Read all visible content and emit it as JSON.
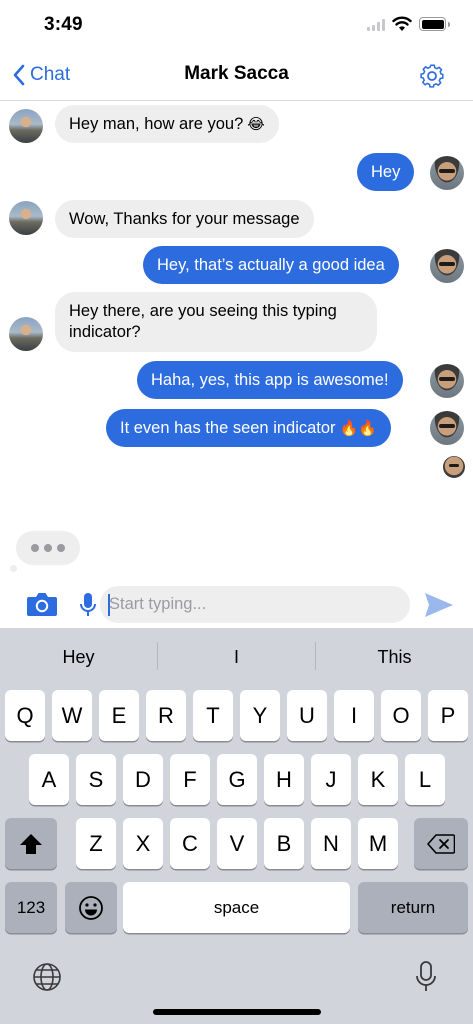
{
  "status_bar": {
    "time": "3:49"
  },
  "nav": {
    "back_label": "Chat",
    "title": "Mark Sacca"
  },
  "messages": [
    {
      "side": "in",
      "text": "Hey man, how are you?",
      "emoji": "😂"
    },
    {
      "side": "out",
      "text": "Hey"
    },
    {
      "side": "in",
      "text": "Wow, Thanks for your message"
    },
    {
      "side": "out",
      "text": "Hey, that’s actually a good idea"
    },
    {
      "side": "in",
      "line1": "Hey there, are you seeing this typing",
      "line2": "indicator?"
    },
    {
      "side": "out",
      "text": "Haha, yes, this app is awesome!"
    },
    {
      "side": "out",
      "text": "It even has the seen indicator",
      "emoji": "🔥🔥"
    }
  ],
  "input": {
    "placeholder": "Start typing..."
  },
  "keyboard": {
    "suggestions": [
      "Hey",
      "I",
      "This"
    ],
    "row1": [
      "Q",
      "W",
      "E",
      "R",
      "T",
      "Y",
      "U",
      "I",
      "O",
      "P"
    ],
    "row2": [
      "A",
      "S",
      "D",
      "F",
      "G",
      "H",
      "J",
      "K",
      "L"
    ],
    "row3": [
      "Z",
      "X",
      "C",
      "V",
      "B",
      "N",
      "M"
    ],
    "numbers_label": "123",
    "space_label": "space",
    "return_label": "return"
  },
  "colors": {
    "accent": "#2d6cdf",
    "incoming_bubble": "#eeeeef",
    "keyboard_bg": "#d1d4db"
  },
  "icons": [
    "back-chevron-icon",
    "gear-icon",
    "camera-icon",
    "microphone-icon",
    "send-icon",
    "shift-icon",
    "backspace-icon",
    "emoji-icon",
    "globe-icon",
    "dictation-icon"
  ]
}
